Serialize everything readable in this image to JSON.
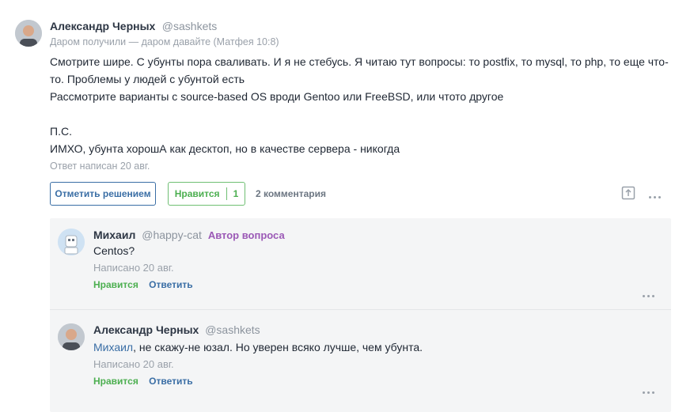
{
  "answer": {
    "author_name": "Александр Черных",
    "author_handle": "@sashkets",
    "quote": "Даром получили — даром давайте (Матфея 10:8)",
    "body_lines": [
      "Смотрите шире. С убунты пора сваливать. И я не стебусь. Я читаю тут вопросы: то postfix, то mysql, то php, то еще что-",
      "то. Проблемы у людей с убунтой есть",
      "Рассмотрите варианты с source-based OS вроди Gentoo или FreeBSD, или чтото другое",
      "",
      "П.С.",
      "ИМХО, убунта хорошА как десктоп, но в качестве сервера - никогда"
    ],
    "date": "Ответ написан 20 авг."
  },
  "actions": {
    "mark_solution": "Отметить решением",
    "like_label": "Нравится",
    "like_count": "1",
    "comments_count": "2 комментария"
  },
  "comments": [
    {
      "author_name": "Михаил",
      "author_handle": "@happy-cat",
      "author_tag": "Автор вопроса",
      "mention": "",
      "text": "Centos?",
      "date": "Написано 20 авг.",
      "like": "Нравится",
      "reply": "Ответить"
    },
    {
      "author_name": "Александр Черных",
      "author_handle": "@sashkets",
      "author_tag": "",
      "mention": "Михаил",
      "text": ", не скажу-не юзал. Но уверен всяко лучше, чем убунта.",
      "date": "Написано 20 авг.",
      "like": "Нравится",
      "reply": "Ответить"
    }
  ],
  "colors": {
    "accent_blue": "#3a6ea5",
    "like_green": "#4caf50",
    "author_tag_purple": "#9b59b6",
    "comments_bg": "#f4f5f6"
  },
  "icons": {
    "share": "share-icon",
    "more": "more-dots-icon",
    "avatar_robot": "robot-avatar-icon"
  }
}
